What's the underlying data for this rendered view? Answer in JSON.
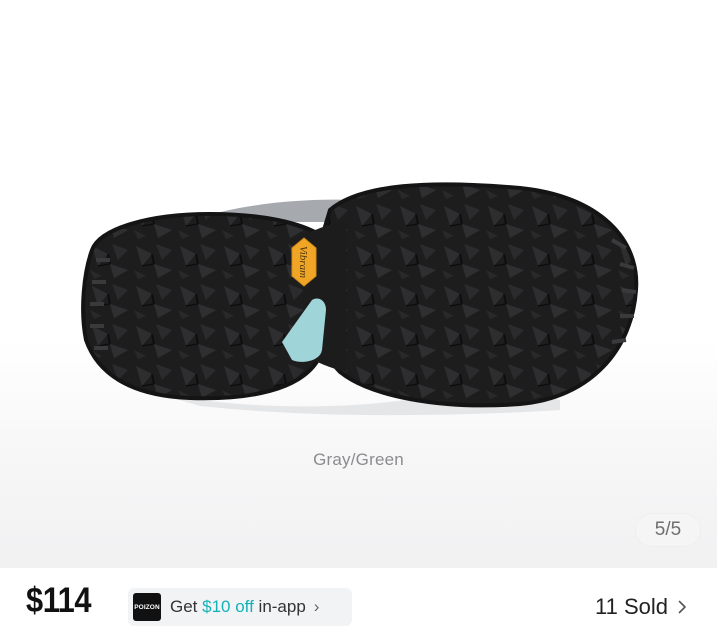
{
  "product": {
    "image_icon": "shoe-outsole-image",
    "logo_text": "Vibram",
    "color_caption": "Gray/Green",
    "image_counter": "5/5"
  },
  "purchase_bar": {
    "price": "$114",
    "promo": {
      "logo_text": "POIZON",
      "prefix": "Get ",
      "amount": "$10 off",
      "suffix": " in-app",
      "chevron": "›"
    },
    "sold_text": "11 Sold",
    "sold_chevron_icon": "chevron-right-icon"
  },
  "colors": {
    "accent": "#12b3b8",
    "price": "#111111",
    "logo_badge": "#f0a526"
  }
}
